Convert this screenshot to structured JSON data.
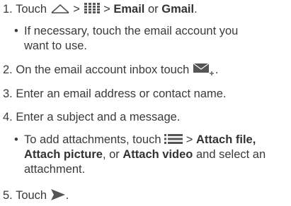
{
  "steps": [
    {
      "num": "1.",
      "pre": "Touch",
      "sep1": ">",
      "sep2": ">",
      "opt1": "Email",
      "or": "or",
      "opt2": "Gmail",
      "end": ".",
      "icons": [
        "home-icon",
        "apps-grid-icon"
      ],
      "sub": {
        "bullet": "•",
        "line1": "If necessary, touch the email account you",
        "line2": "want to use."
      }
    },
    {
      "num": "2.",
      "text": "On the email account inbox touch",
      "end": ".",
      "icons": [
        "compose-email-icon"
      ]
    },
    {
      "num": "3.",
      "text": "Enter an email address or contact name."
    },
    {
      "num": "4.",
      "text": "Enter a subject and a message.",
      "sub": {
        "bullet": "•",
        "pre": "To add attachments, touch",
        "sep": ">",
        "opt1": "Attach file,",
        "opt2": "Attach picture",
        "comma": ", or",
        "opt3": "Attach video",
        "tail": "and select an",
        "line3": "attachment.",
        "icons": [
          "menu-icon"
        ]
      }
    },
    {
      "num": "5.",
      "pre": "Touch",
      "end": ".",
      "icons": [
        "send-icon"
      ]
    }
  ],
  "colors": {
    "text": "#3a3a3a",
    "icon": "#555555"
  }
}
